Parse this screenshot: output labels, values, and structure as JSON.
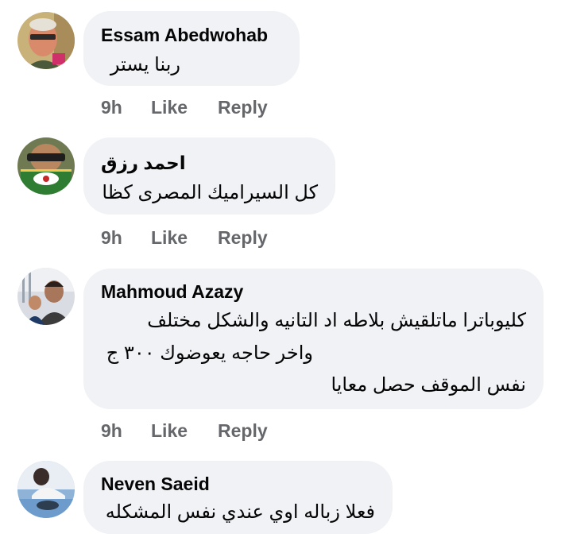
{
  "comments": [
    {
      "author": "Essam Abedwohab",
      "lines": [
        "ربنا يستر"
      ],
      "time": "9h",
      "like_label": "Like",
      "reply_label": "Reply",
      "avatar_icon": "profile-photo-icon"
    },
    {
      "author": "احمد رزق",
      "lines": [
        "كل السيراميك المصرى كظا"
      ],
      "time": "9h",
      "like_label": "Like",
      "reply_label": "Reply",
      "avatar_icon": "profile-photo-icon"
    },
    {
      "author": "Mahmoud Azazy",
      "lines": [
        "كليوباترا ماتلقيش بلاطه اد التانيه والشكل مختلف",
        "واخر حاجه يعوضوك ٣٠٠ ج",
        "نفس الموقف حصل معايا"
      ],
      "time": "9h",
      "like_label": "Like",
      "reply_label": "Reply",
      "avatar_icon": "profile-photo-icon"
    },
    {
      "author": "Neven Saeid",
      "lines": [
        "فعلا زباله اوي عندي نفس المشكله"
      ],
      "avatar_icon": "profile-photo-icon"
    }
  ],
  "colors": {
    "bubble": "#f0f2f5",
    "secondary_text": "#65676b",
    "primary_text": "#050505"
  }
}
